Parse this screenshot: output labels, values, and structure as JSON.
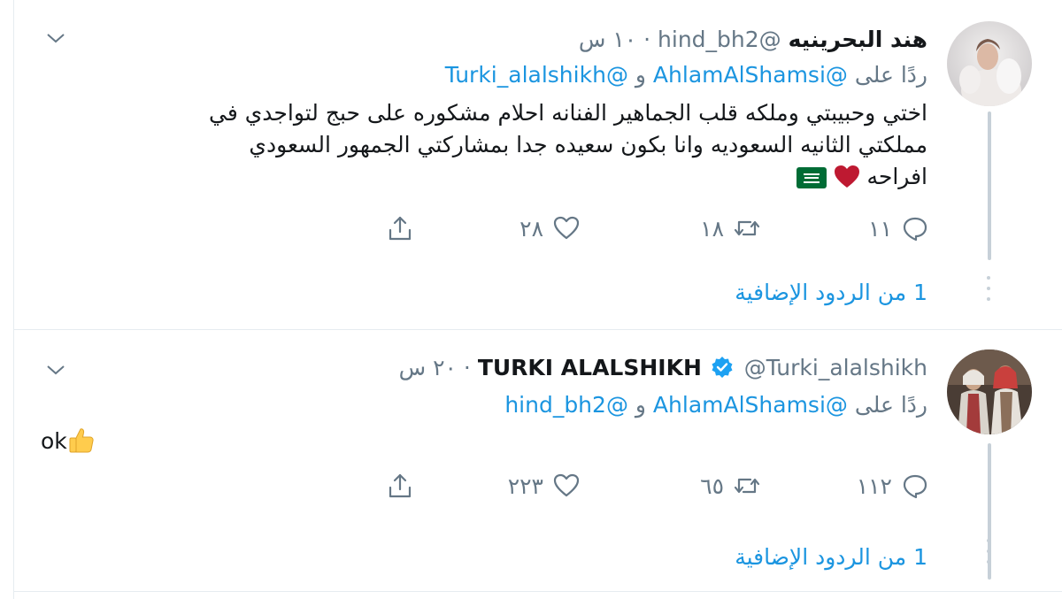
{
  "tweets": [
    {
      "name": "هند البحرينيه",
      "handle": "@hind_bh2",
      "time": "١٠ س",
      "separator": "·",
      "verified": false,
      "reply_prefix": "ردًا على",
      "reply_user_1": "@AhlamAlShamsi",
      "reply_and": "و",
      "reply_user_2": "@Turki_alalshikh",
      "text_line_1": "اختي وحبيبتي وملكه قلب الجماهير الفنانه احلام مشكوره على حبج لتواجدي في",
      "text_line_2": "مملكتي الثانيه السعوديه وانا بكون سعيده جدا بمشاركتي الجمهور السعودي",
      "text_line_3": "افراحه",
      "emojis": [
        "red-heart",
        "flag-saudi-arabia"
      ],
      "counts": {
        "reply": "١١",
        "retweet": "١٨",
        "like": "٢٨"
      },
      "more_replies": "1 من الردود الإضافية"
    },
    {
      "name": "TURKI ALALSHIKH",
      "handle": "@Turki_alalshikh",
      "time": "٢٠ س",
      "separator": "·",
      "verified": true,
      "reply_prefix": "ردًا على",
      "reply_user_1": "@AhlamAlShamsi",
      "reply_and": "و",
      "reply_user_2": "@hind_bh2",
      "text_line_1": "ok",
      "emojis": [
        "thumbs-up"
      ],
      "counts": {
        "reply": "١١٢",
        "retweet": "٦٥",
        "like": "٢٢٣"
      },
      "more_replies": "1 من الردود الإضافية"
    }
  ],
  "colors": {
    "link": "#1b95e0",
    "muted": "#657786",
    "text": "#14171a",
    "border": "#e6ecf0",
    "verified": "#1da1f2",
    "heart": "#be1931",
    "thread": "#c7d0d8"
  }
}
